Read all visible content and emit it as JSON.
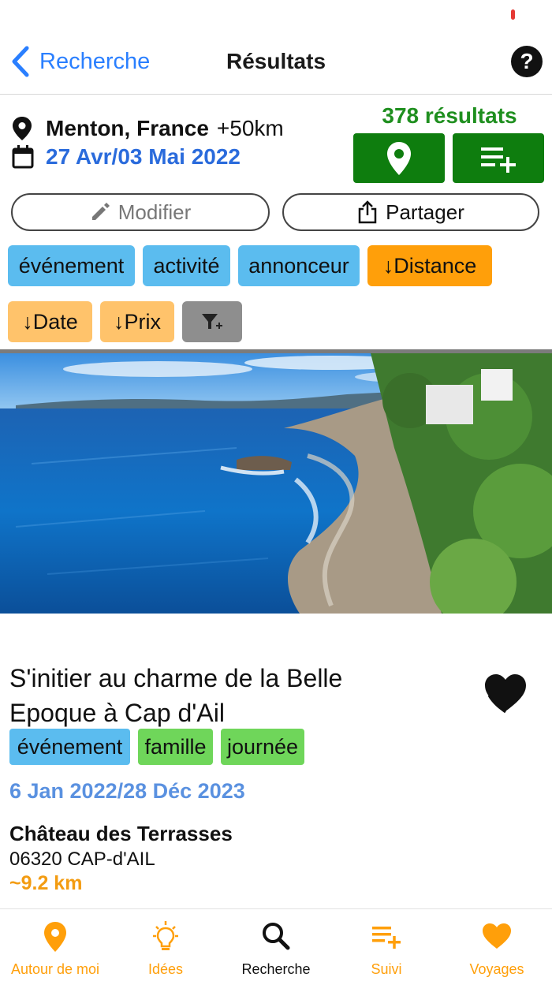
{
  "nav": {
    "back_label": "Recherche",
    "title": "Résultats",
    "help_label": "?"
  },
  "search": {
    "location": "Menton, France",
    "radius": "+50km",
    "dates": "27 Avr/03 Mai 2022",
    "result_count": "378 résultats",
    "edit_label": "Modifier",
    "share_label": "Partager"
  },
  "filters": [
    {
      "label": "événement",
      "style": "blue"
    },
    {
      "label": "activité",
      "style": "blue"
    },
    {
      "label": "annonceur",
      "style": "blue"
    },
    {
      "label": "↓Distance",
      "style": "orange"
    },
    {
      "label": "↓Date",
      "style": "lightorange"
    },
    {
      "label": "↓Prix",
      "style": "lightorange"
    },
    {
      "label": "filter-plus-icon",
      "style": "gray"
    }
  ],
  "card": {
    "title": "S'initier au charme de la Belle Epoque à Cap d'Ail",
    "tags": [
      "événement",
      "famille",
      "journée"
    ],
    "dates": "6 Jan 2022/28 Déc 2023",
    "venue": "Château des Terrasses",
    "address": "06320 CAP-d'AIL",
    "distance": "~9.2 km"
  },
  "tabs": [
    {
      "label": "Autour de moi",
      "icon": "map-pin-icon"
    },
    {
      "label": "Idées",
      "icon": "lightbulb-icon"
    },
    {
      "label": "Recherche",
      "icon": "search-icon",
      "active": true
    },
    {
      "label": "Suivi",
      "icon": "list-add-icon"
    },
    {
      "label": "Voyages",
      "icon": "heart-icon"
    }
  ],
  "colors": {
    "accent_blue": "#2a7fff",
    "green": "#0e7d0e",
    "orange": "#ff9f0a",
    "chip_blue": "#5bbcef"
  }
}
